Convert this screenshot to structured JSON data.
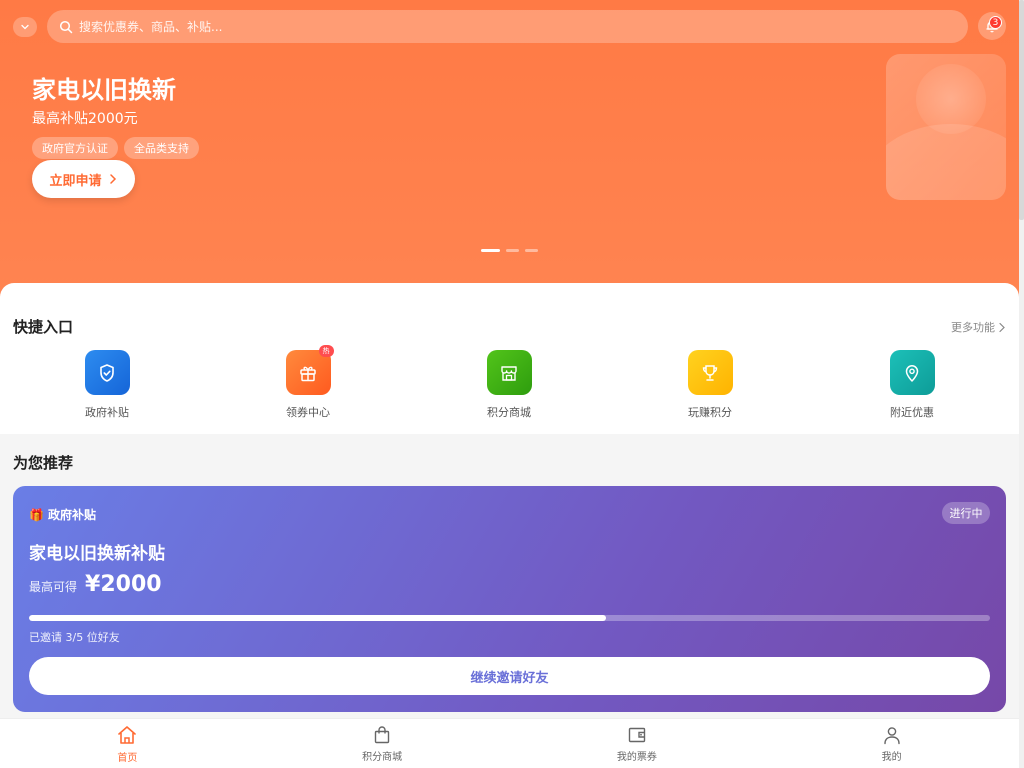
{
  "header": {
    "search_placeholder": "搜索优惠券、商品、补贴...",
    "notification_count": "3"
  },
  "hero": {
    "title": "家电以旧换新",
    "subtitle": "最高补贴2000元",
    "tags": [
      "政府官方认证",
      "全品类支持"
    ],
    "cta_label": "立即申请",
    "slides": 3,
    "active_slide": 0
  },
  "quick_entry": {
    "title": "快捷入口",
    "more_label": "更多功能",
    "items": [
      {
        "label": "政府补贴",
        "icon": "shield-check-icon",
        "color": "#1a73e8"
      },
      {
        "label": "领券中心",
        "icon": "gift-icon",
        "color": "#ff6a33",
        "badge": "热"
      },
      {
        "label": "积分商城",
        "icon": "store-icon",
        "color": "#3fb618"
      },
      {
        "label": "玩赚积分",
        "icon": "trophy-icon",
        "color": "#ffb300"
      },
      {
        "label": "附近优惠",
        "icon": "location-pin-icon",
        "color": "#13a8a8"
      }
    ]
  },
  "recommend": {
    "title": "为您推荐",
    "card": {
      "tag": "政府补贴",
      "tag_icon": "🎁",
      "status": "进行中",
      "title": "家电以旧换新补贴",
      "amount_label": "最高可得",
      "amount": "¥2000",
      "progress_fraction": 0.6,
      "progress_text": "已邀请 3/5 位好友",
      "button_label": "继续邀请好友"
    }
  },
  "bottom_nav": {
    "items": [
      {
        "label": "首页",
        "icon": "home-icon",
        "active": true
      },
      {
        "label": "积分商城",
        "icon": "shopping-bag-icon",
        "active": false
      },
      {
        "label": "我的票券",
        "icon": "wallet-icon",
        "active": false
      },
      {
        "label": "我的",
        "icon": "user-icon",
        "active": false
      }
    ]
  },
  "colors": {
    "brand": "#ff6a33",
    "hero_bg": "#ff7a45",
    "promo_start": "#6a7ee6",
    "promo_end": "#7648a8"
  }
}
